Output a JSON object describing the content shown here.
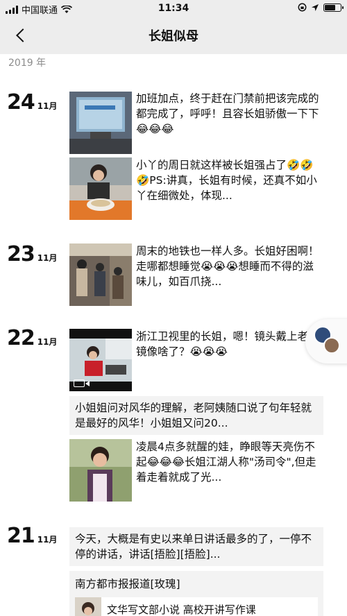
{
  "status_bar": {
    "carrier": "中国联通",
    "time": "11:34"
  },
  "nav": {
    "title": "长姐似母"
  },
  "year_label": "2019 年",
  "days": [
    {
      "day": "24",
      "month": "11月",
      "posts": [
        {
          "text": "加班加点，终于赶在门禁前把该完成的都完成了，呼呼！且容长姐骄傲一下下😂😂😂"
        },
        {
          "text": "小丫的周日就这样被长姐强占了🤣🤣🤣PS:讲真，长姐有时候，还真不如小丫在细微处，体现..."
        }
      ]
    },
    {
      "day": "23",
      "month": "11月",
      "posts": [
        {
          "text": "周末的地铁也一样人多。长姐好困啊！走哪都想睡觉😭😭😭想睡而不得的滋味儿，如百爪挠..."
        }
      ]
    },
    {
      "day": "22",
      "month": "11月",
      "posts": [
        {
          "text": "浙江卫视里的长姐，嗯！镜头戴上老花镜像啥了？😭😭😭"
        },
        {
          "text": "小姐姐问对风华的理解，老阿姨随口说了句年轻就是最好的风华！小姐姐又问20..."
        },
        {
          "text": "凌晨4点多就醒的娃，睁眼等天亮伤不起😂😂😂长姐江湖人称\"汤司令\",但走着走着就成了光..."
        }
      ]
    },
    {
      "day": "21",
      "month": "11月",
      "posts": [
        {
          "text": "今天，大概是有史以来单日讲话最多的了，一停不停的讲话，讲话[捂脸][捂脸]..."
        },
        {
          "text": "南方都市报报道[玫瑰]"
        },
        {
          "text": "文华写文部小说 高校开讲写作课"
        }
      ]
    }
  ]
}
